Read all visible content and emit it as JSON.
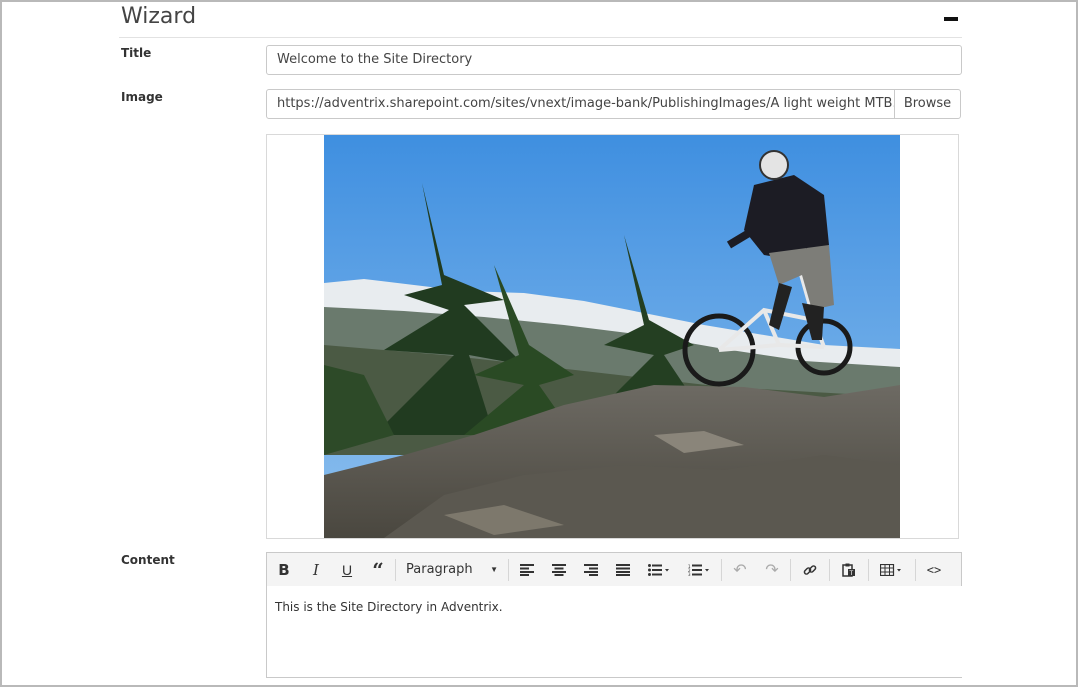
{
  "section": {
    "title": "Wizard"
  },
  "form": {
    "title_label": "Title",
    "title_value": "Welcome to the Site Directory",
    "image_label": "Image",
    "image_url": "https://adventrix.sharepoint.com/sites/vnext/image-bank/PublishingImages/A light weight MTB.jpg",
    "browse_label": "Browse",
    "content_label": "Content"
  },
  "editor": {
    "format_select": "Paragraph",
    "body_text": "This is the Site Directory in Adventrix.",
    "toolbar_icons": [
      "bold-icon",
      "italic-icon",
      "underline-icon",
      "blockquote-icon",
      "align-left-icon",
      "align-center-icon",
      "align-right-icon",
      "align-justify-icon",
      "bullet-list-icon",
      "numbered-list-icon",
      "undo-icon",
      "redo-icon",
      "link-icon",
      "paste-text-icon",
      "table-icon",
      "source-code-icon"
    ]
  },
  "colors": {
    "sky": "#5a9ee0",
    "border": "#c9c9c9",
    "toolbar_bg": "#f4f4f4"
  }
}
